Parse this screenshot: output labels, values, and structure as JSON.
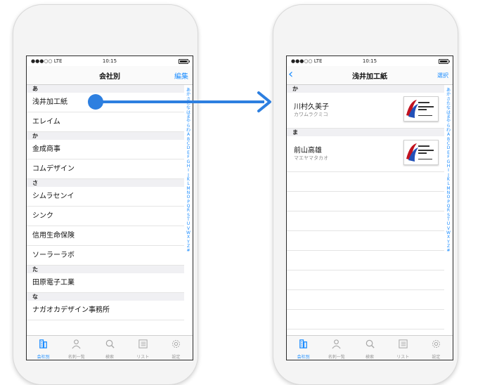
{
  "left_screen": {
    "status": {
      "carrier": "●●●○○ LTE",
      "time": "10:15"
    },
    "nav": {
      "title": "会社別",
      "edit_label": "編集"
    },
    "sections": [
      {
        "header": "あ",
        "rows": [
          "浅井加工紙",
          "エレイム"
        ]
      },
      {
        "header": "か",
        "rows": [
          "金成商事",
          "コムデザイン"
        ]
      },
      {
        "header": "さ",
        "rows": [
          "シムラセンイ",
          "シンク",
          "信用生命保険",
          "ソーラーラボ"
        ]
      },
      {
        "header": "た",
        "rows": [
          "田原電子工業"
        ]
      },
      {
        "header": "な",
        "rows": [
          "ナガオカデザイン事務所"
        ]
      }
    ]
  },
  "right_screen": {
    "status": {
      "carrier": "●●●○○ LTE",
      "time": "10:15"
    },
    "nav": {
      "title": "浅井加工紙",
      "select_label": "選択"
    },
    "sections": [
      {
        "header": "か",
        "contacts": [
          {
            "name": "川村久美子",
            "reading": "カワムラクミコ"
          }
        ]
      },
      {
        "header": "ま",
        "contacts": [
          {
            "name": "前山高雄",
            "reading": "マエヤマタカオ"
          }
        ]
      }
    ]
  },
  "index_letters": [
    "あ",
    "か",
    "さ",
    "た",
    "な",
    "は",
    "ま",
    "や",
    "ら",
    "わ",
    "A",
    "B",
    "C",
    "D",
    "E",
    "F",
    "G",
    "H",
    "I",
    "J",
    "K",
    "L",
    "M",
    "N",
    "O",
    "P",
    "Q",
    "R",
    "S",
    "T",
    "U",
    "V",
    "W",
    "X",
    "Y",
    "Z",
    "#"
  ],
  "tabs": [
    {
      "label": "会社別",
      "icon": "building-icon"
    },
    {
      "label": "名刺一覧",
      "icon": "person-icon"
    },
    {
      "label": "検索",
      "icon": "search-icon"
    },
    {
      "label": "リスト",
      "icon": "list-icon"
    },
    {
      "label": "設定",
      "icon": "gear-icon"
    }
  ],
  "colors": {
    "accent": "#1a8cff",
    "arrow": "#2d7fe0"
  }
}
